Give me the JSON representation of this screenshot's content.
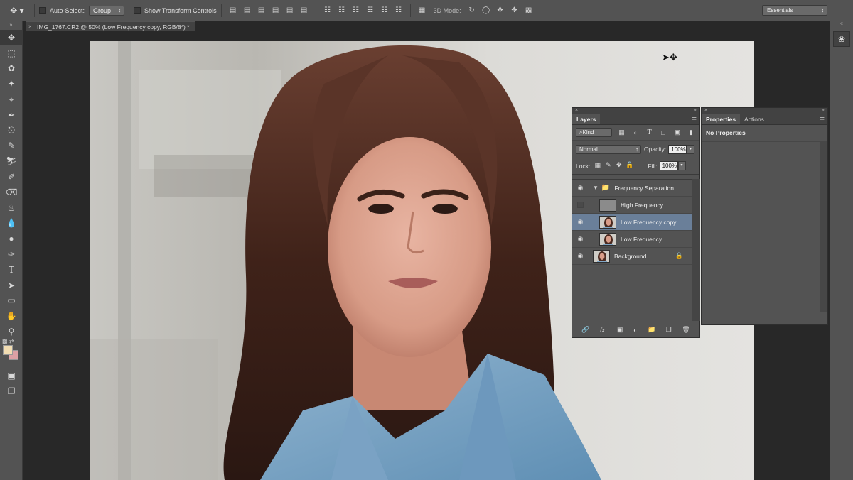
{
  "options_bar": {
    "auto_select_label": "Auto-Select:",
    "auto_select_value": "Group",
    "transform_label": "Show Transform Controls",
    "mode_3d_label": "3D Mode:",
    "workspace": "Essentials"
  },
  "document": {
    "tab_title": "IMG_1767.CR2 @ 50% (Low Frequency copy, RGB/8*) *"
  },
  "colors": {
    "foreground": "#f2ddb2",
    "background": "#dca1a4",
    "selected_layer": "#6a7f99"
  },
  "layers_panel": {
    "tab": "Layers",
    "filter_kind": "Kind",
    "blend_mode": "Normal",
    "opacity_label": "Opacity:",
    "opacity_value": "100%",
    "lock_label": "Lock:",
    "fill_label": "Fill:",
    "fill_value": "100%",
    "layers": [
      {
        "name": "Frequency Separation",
        "type": "group",
        "visible": true
      },
      {
        "name": "High Frequency",
        "type": "gray",
        "visible": false
      },
      {
        "name": "Low Frequency copy",
        "type": "photo",
        "visible": true,
        "selected": true
      },
      {
        "name": "Low Frequency",
        "type": "photo",
        "visible": true
      },
      {
        "name": "Background",
        "type": "photo",
        "visible": true,
        "locked": true
      }
    ]
  },
  "properties_panel": {
    "tabs": [
      "Properties",
      "Actions"
    ],
    "message": "No Properties"
  }
}
